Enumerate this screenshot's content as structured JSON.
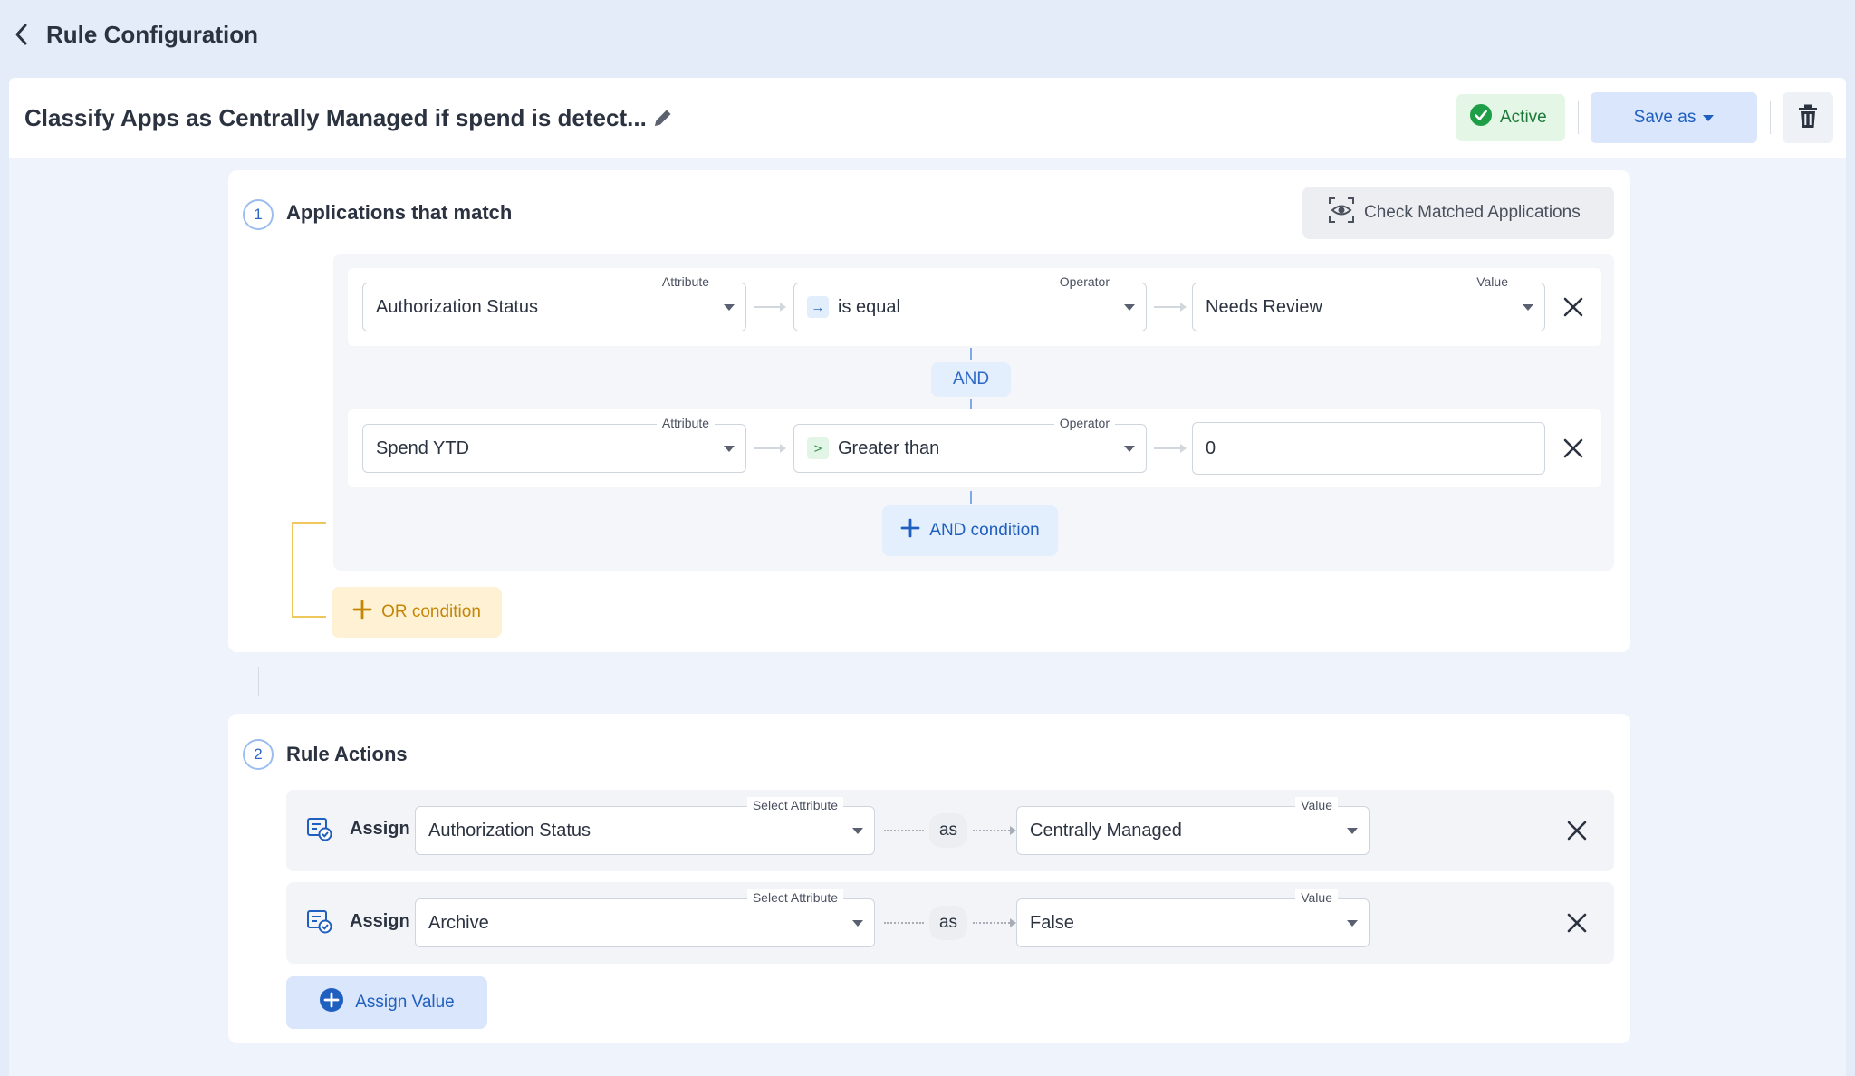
{
  "header": {
    "title": "Rule Configuration"
  },
  "rule": {
    "name": "Classify Apps as Centrally Managed if spend is detect...",
    "status": "Active",
    "save_label": "Save as"
  },
  "conditions_section": {
    "step": "1",
    "title": "Applications that match",
    "check_button": "Check Matched Applications",
    "rows": [
      {
        "attribute_label": "Attribute",
        "attribute": "Authorization Status",
        "operator_label": "Operator",
        "operator_symbol": "→",
        "operator": "is equal",
        "value_label": "Value",
        "value": "Needs Review"
      },
      {
        "attribute_label": "Attribute",
        "attribute": "Spend YTD",
        "operator_label": "Operator",
        "operator_symbol": ">",
        "operator": "Greater than",
        "value": "0"
      }
    ],
    "and_label": "AND",
    "and_condition_button": "AND condition",
    "or_condition_button": "OR condition"
  },
  "actions_section": {
    "step": "2",
    "title": "Rule Actions",
    "actions": [
      {
        "assign_label": "Assign",
        "attribute_label": "Select Attribute",
        "attribute": "Authorization Status",
        "as_label": "as",
        "value_label": "Value",
        "value": "Centrally Managed"
      },
      {
        "assign_label": "Assign",
        "attribute_label": "Select Attribute",
        "attribute": "Archive",
        "as_label": "as",
        "value_label": "Value",
        "value": "False"
      }
    ],
    "assign_value_button": "Assign Value"
  },
  "colors": {
    "accent": "#1f5fbf",
    "active_green": "#1d9e47",
    "or_orange": "#c48606",
    "background": "#e4ecfa"
  },
  "icons": {
    "back": "chevron-left-icon",
    "edit": "pencil-icon",
    "status": "check-circle-icon",
    "save_caret": "caret-down-icon",
    "delete": "trash-icon",
    "check_matched": "eye-scan-icon",
    "remove": "close-icon",
    "add": "plus-icon",
    "assign": "assign-attribute-icon"
  }
}
